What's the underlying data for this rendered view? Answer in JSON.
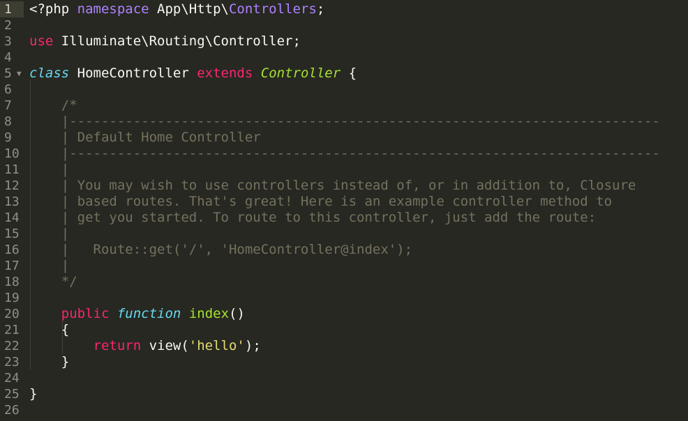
{
  "editor": {
    "theme_colors": {
      "background": "#272822",
      "foreground": "#f8f8f2",
      "keyword": "#f92672",
      "namespace": "#ae81ff",
      "storage": "#66d9ef",
      "class_name": "#a6e22e",
      "string": "#e6db74",
      "comment": "#75715e",
      "gutter_text": "#8f908a",
      "active_line_gutter": "#3e3d32"
    },
    "active_line": 1,
    "fold_markers": [
      5
    ],
    "line_numbers": [
      "1",
      "2",
      "3",
      "4",
      "5",
      "6",
      "7",
      "8",
      "9",
      "10",
      "11",
      "12",
      "13",
      "14",
      "15",
      "16",
      "17",
      "18",
      "19",
      "20",
      "21",
      "22",
      "23",
      "24",
      "25",
      "26"
    ],
    "lines": [
      [
        [
          "pl",
          "<?php "
        ],
        [
          "pur",
          "namespace"
        ],
        [
          "pl",
          " App\\Http\\"
        ],
        [
          "pur",
          "Controllers"
        ],
        [
          "pl",
          ";"
        ]
      ],
      [],
      [
        [
          "kw",
          "use"
        ],
        [
          "pl",
          " Illuminate\\Routing\\Controller;"
        ]
      ],
      [],
      [
        [
          "sto",
          "class"
        ],
        [
          "pl",
          " HomeController "
        ],
        [
          "kw",
          "extends"
        ],
        [
          "pl",
          " "
        ],
        [
          "cls",
          "Controller"
        ],
        [
          "pl",
          " {"
        ]
      ],
      [],
      [
        [
          "pl",
          "    "
        ],
        [
          "cm",
          "/*"
        ]
      ],
      [
        [
          "pl",
          "    "
        ],
        [
          "cm",
          "|--------------------------------------------------------------------------"
        ]
      ],
      [
        [
          "pl",
          "    "
        ],
        [
          "cm",
          "| Default Home Controller"
        ]
      ],
      [
        [
          "pl",
          "    "
        ],
        [
          "cm",
          "|--------------------------------------------------------------------------"
        ]
      ],
      [
        [
          "pl",
          "    "
        ],
        [
          "cm",
          "|"
        ]
      ],
      [
        [
          "pl",
          "    "
        ],
        [
          "cm",
          "| You may wish to use controllers instead of, or in addition to, Closure"
        ]
      ],
      [
        [
          "pl",
          "    "
        ],
        [
          "cm",
          "| based routes. That's great! Here is an example controller method to"
        ]
      ],
      [
        [
          "pl",
          "    "
        ],
        [
          "cm",
          "| get you started. To route to this controller, just add the route:"
        ]
      ],
      [
        [
          "pl",
          "    "
        ],
        [
          "cm",
          "|"
        ]
      ],
      [
        [
          "pl",
          "    "
        ],
        [
          "cm",
          "|   Route::get('/', 'HomeController@index');"
        ]
      ],
      [
        [
          "pl",
          "    "
        ],
        [
          "cm",
          "|"
        ]
      ],
      [
        [
          "pl",
          "    "
        ],
        [
          "cm",
          "*/"
        ]
      ],
      [],
      [
        [
          "pl",
          "    "
        ],
        [
          "kw",
          "public"
        ],
        [
          "pl",
          " "
        ],
        [
          "sto",
          "function"
        ],
        [
          "pl",
          " "
        ],
        [
          "fn",
          "index"
        ],
        [
          "pl",
          "()"
        ]
      ],
      [
        [
          "pl",
          "    {"
        ]
      ],
      [
        [
          "pl",
          "        "
        ],
        [
          "kw",
          "return"
        ],
        [
          "pl",
          " view("
        ],
        [
          "str",
          "'hello'"
        ],
        [
          "pl",
          ");"
        ]
      ],
      [
        [
          "pl",
          "    }"
        ]
      ],
      [],
      [
        [
          "pl",
          "}"
        ]
      ],
      []
    ]
  }
}
